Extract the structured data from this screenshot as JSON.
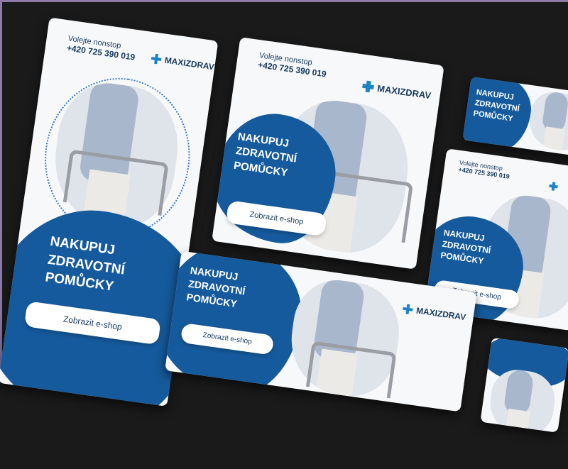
{
  "brand": "MAXIZDRAV",
  "contact_label": "Volejte nonstop",
  "phone": "+420 725 390 019",
  "headline": [
    "NAKUPUJ",
    "ZDRAVOTNÍ",
    "POMŮCKY"
  ],
  "cta_label": "Zobrazit e-shop",
  "colors": {
    "brand_blue": "#155a9c",
    "text_dark": "#163a5e",
    "accent_cross": "#1c83c6",
    "background": "#1a1a1a"
  }
}
